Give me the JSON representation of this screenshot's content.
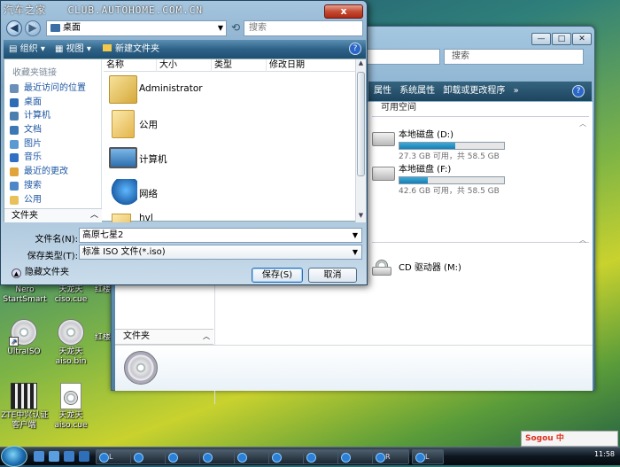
{
  "watermark": {
    "site": "汽车之家",
    "url": "CLUB.AUTOHOME.COM.CN"
  },
  "desktop_icons": [
    {
      "label": "Nero\nStartSmart"
    },
    {
      "label": "天龙天\nciso.cue"
    },
    {
      "label": "红楼"
    },
    {
      "label": "UltraISO"
    },
    {
      "label": "天龙天\naiso.bin"
    },
    {
      "label": "红楼"
    },
    {
      "label": "ZTE中兴认证\n客户端"
    },
    {
      "label": "天龙天\naiso.cue"
    }
  ],
  "bg_window": {
    "search_placeholder": "搜索",
    "toolbar": {
      "properties": "属性",
      "system_properties": "系统属性",
      "uninstall": "卸载或更改程序",
      "more": "»"
    },
    "free_space_col": "可用空间",
    "drives": [
      {
        "name": "本地磁盘 (D:)",
        "detail": "27.3 GB 可用，共 58.5 GB",
        "used_fraction": 0.53
      },
      {
        "name": "本地磁盘 (F:)",
        "detail": "42.6 GB 可用，共 58.5 GB",
        "used_fraction": 0.27
      }
    ],
    "cd_drive": "CD 驱动器 (M:)",
    "folders_label": "文件夹"
  },
  "dialog": {
    "close": "x",
    "address": "桌面",
    "search_placeholder": "搜索",
    "toolbar": {
      "organize": "组织",
      "views": "视图",
      "new_folder": "新建文件夹"
    },
    "favorites_header": "收藏夹链接",
    "favorites": [
      "最近访问的位置",
      "桌面",
      "计算机",
      "文档",
      "图片",
      "音乐",
      "最近的更改",
      "搜索",
      "公用"
    ],
    "folders_label": "文件夹",
    "columns": [
      "名称",
      "大小",
      "类型",
      "修改日期"
    ],
    "files": [
      "Administrator",
      "公用",
      "计算机",
      "网络",
      "hvl"
    ],
    "filename_label": "文件名(N):",
    "filename_value": "高原七星2",
    "filetype_label": "保存类型(T):",
    "filetype_value": "标准 ISO 文件(*.iso)",
    "hide_folders": "隐藏文件夹",
    "save": "保存(S)",
    "cancel": "取消"
  },
  "taskbar": {
    "buttons": [
      "L",
      "",
      "",
      "",
      "",
      "",
      "",
      "",
      "R",
      "L"
    ],
    "tray": "Sogou 中",
    "clock": "11:58"
  }
}
